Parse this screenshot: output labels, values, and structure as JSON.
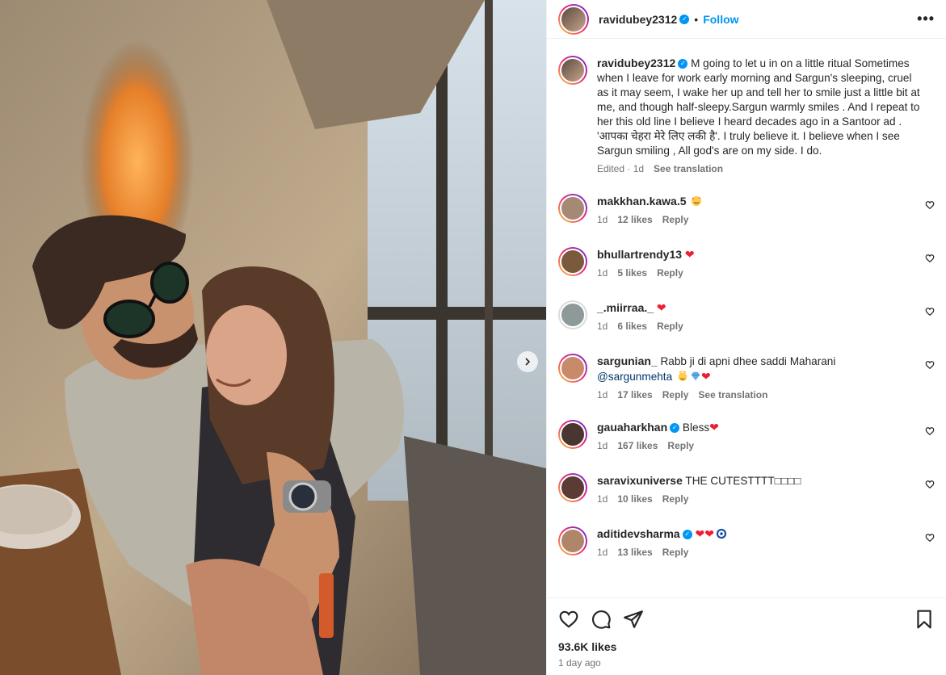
{
  "post": {
    "username": "ravidubey2312",
    "follow_label": "Follow",
    "dot": "•",
    "caption": "M going to let u in on a little ritual Sometimes when I leave for work early morning and Sargun's sleeping, cruel as it may seem, I wake her up and tell her to smile just a little bit at me, and though half-sleepy.Sargun warmly smiles . And I repeat to her this old line I believe I heard decades ago in a Santoor ad . 'आपका चेहरा मेरे लिए लकी है'. I truly believe it. I believe when I see Sargun smiling , All god's are on my side. I do.",
    "edited_label": "Edited · 1d",
    "see_translation": "See translation",
    "likes": "93.6K likes",
    "posted": "1 day ago"
  },
  "comments": [
    {
      "username": "makkhan.kawa.5",
      "text": "",
      "emoji": [
        "smiling-face-with-hearts"
      ],
      "time": "1d",
      "likes": "12 likes",
      "reply": "Reply",
      "verified": false,
      "avatar_color": "#a48a74"
    },
    {
      "username": "bhullartrendy13",
      "text": "",
      "emoji": [
        "red-heart"
      ],
      "time": "1d",
      "likes": "5 likes",
      "reply": "Reply",
      "verified": false,
      "avatar_color": "#7a5a3c"
    },
    {
      "username": "_.miirraa._",
      "text": "",
      "emoji": [
        "red-heart"
      ],
      "time": "1d",
      "likes": "6 likes",
      "reply": "Reply",
      "verified": false,
      "avatar_color": "#8e9a9a",
      "ring": false
    },
    {
      "username": "sargunian_",
      "text": "Rabb ji di apni dhee saddi Maharani",
      "mention": "@sargunmehta",
      "emoji": [
        "angel",
        "gem",
        "red-heart"
      ],
      "time": "1d",
      "likes": "17 likes",
      "reply": "Reply",
      "see_translation": "See translation",
      "verified": false,
      "avatar_color": "#c98a6c"
    },
    {
      "username": "gauaharkhan",
      "text": "Bless",
      "emoji": [
        "red-heart"
      ],
      "time": "1d",
      "likes": "167 likes",
      "reply": "Reply",
      "verified": true,
      "avatar_color": "#4a3630"
    },
    {
      "username": "saravixuniverse",
      "text": "THE CUTESTTTT□□□□",
      "emoji": [],
      "time": "1d",
      "likes": "10 likes",
      "reply": "Reply",
      "verified": false,
      "avatar_color": "#5b3b34"
    },
    {
      "username": "aditidevsharma",
      "text": "",
      "emoji": [
        "red-heart",
        "red-heart",
        "nazar-amulet"
      ],
      "time": "1d",
      "likes": "13 likes",
      "reply": "Reply",
      "verified": true,
      "avatar_color": "#b0866a"
    }
  ],
  "icons": {
    "like": "heart-outline-icon",
    "comment": "comment-bubble-icon",
    "share": "paper-plane-icon",
    "save": "bookmark-icon",
    "more": "more-options-icon",
    "next": "chevron-right-icon"
  },
  "colors": {
    "accent": "#0095f6",
    "heart": "#ed1d34",
    "muted": "#737373",
    "text": "#262626"
  }
}
